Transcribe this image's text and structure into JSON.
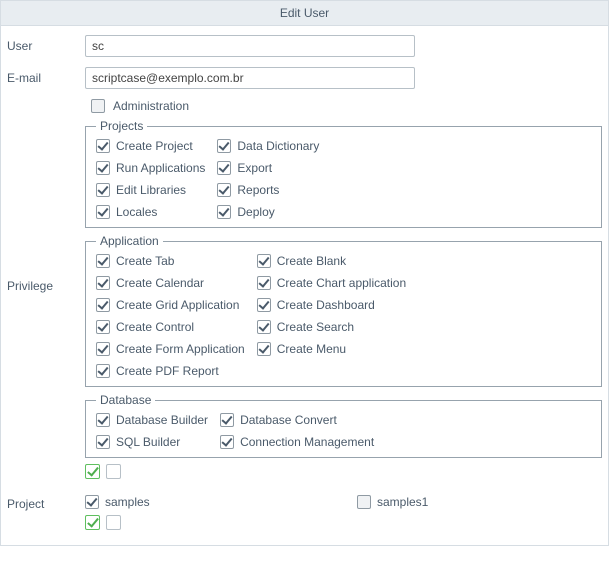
{
  "header": {
    "title": "Edit User"
  },
  "user": {
    "label": "User",
    "value": "sc"
  },
  "email": {
    "label": "E-mail",
    "value": "scriptcase@exemplo.com.br"
  },
  "administration": {
    "label": "Administration",
    "checked": false
  },
  "privilege": {
    "label": "Privilege",
    "groups": {
      "projects": {
        "legend": "Projects",
        "items": [
          {
            "label": "Create Project",
            "checked": true
          },
          {
            "label": "Data Dictionary",
            "checked": true
          },
          {
            "label": "Run Applications",
            "checked": true
          },
          {
            "label": "Export",
            "checked": true
          },
          {
            "label": "Edit Libraries",
            "checked": true
          },
          {
            "label": "Reports",
            "checked": true
          },
          {
            "label": "Locales",
            "checked": true
          },
          {
            "label": "Deploy",
            "checked": true
          }
        ]
      },
      "application": {
        "legend": "Application",
        "items": [
          {
            "label": "Create Tab",
            "checked": true
          },
          {
            "label": "Create Blank",
            "checked": true
          },
          {
            "label": "Create Calendar",
            "checked": true
          },
          {
            "label": "Create Chart application",
            "checked": true
          },
          {
            "label": "Create Grid Application",
            "checked": true
          },
          {
            "label": "Create Dashboard",
            "checked": true
          },
          {
            "label": "Create Control",
            "checked": true
          },
          {
            "label": "Create Search",
            "checked": true
          },
          {
            "label": "Create Form Application",
            "checked": true
          },
          {
            "label": "Create Menu",
            "checked": true
          },
          {
            "label": "Create PDF Report",
            "checked": true
          }
        ]
      },
      "database": {
        "legend": "Database",
        "items": [
          {
            "label": "Database Builder",
            "checked": true
          },
          {
            "label": "Database Convert",
            "checked": true
          },
          {
            "label": "SQL Builder",
            "checked": true
          },
          {
            "label": "Connection Management",
            "checked": true
          }
        ]
      }
    }
  },
  "project": {
    "label": "Project",
    "items": [
      {
        "label": "samples",
        "checked": true
      },
      {
        "label": "samples1",
        "checked": false
      }
    ]
  }
}
